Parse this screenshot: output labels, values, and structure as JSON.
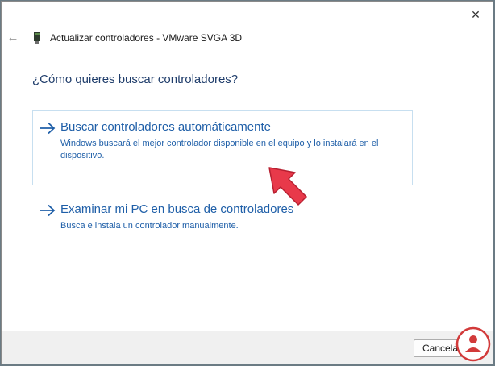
{
  "window": {
    "title": "Actualizar controladores - VMware SVGA 3D",
    "close_icon": "close-icon",
    "back_icon": "back-arrow-icon",
    "device_icon": "device-card-icon"
  },
  "main": {
    "question": "¿Cómo quieres buscar controladores?",
    "options": [
      {
        "title": "Buscar controladores automáticamente",
        "description": "Windows buscará el mejor controlador disponible en el equipo y lo instalará en el dispositivo.",
        "icon": "arrow-right-icon",
        "selected": true
      },
      {
        "title": "Examinar mi PC en busca de controladores",
        "description": "Busca e instala un controlador manualmente.",
        "icon": "arrow-right-icon",
        "selected": false
      }
    ],
    "pointer_color": "#e8394a"
  },
  "footer": {
    "cancel_label": "Cancelar"
  },
  "colors": {
    "link": "#1f5fa8",
    "question": "#1f3d6b",
    "selected_border": "#c7dff0"
  }
}
